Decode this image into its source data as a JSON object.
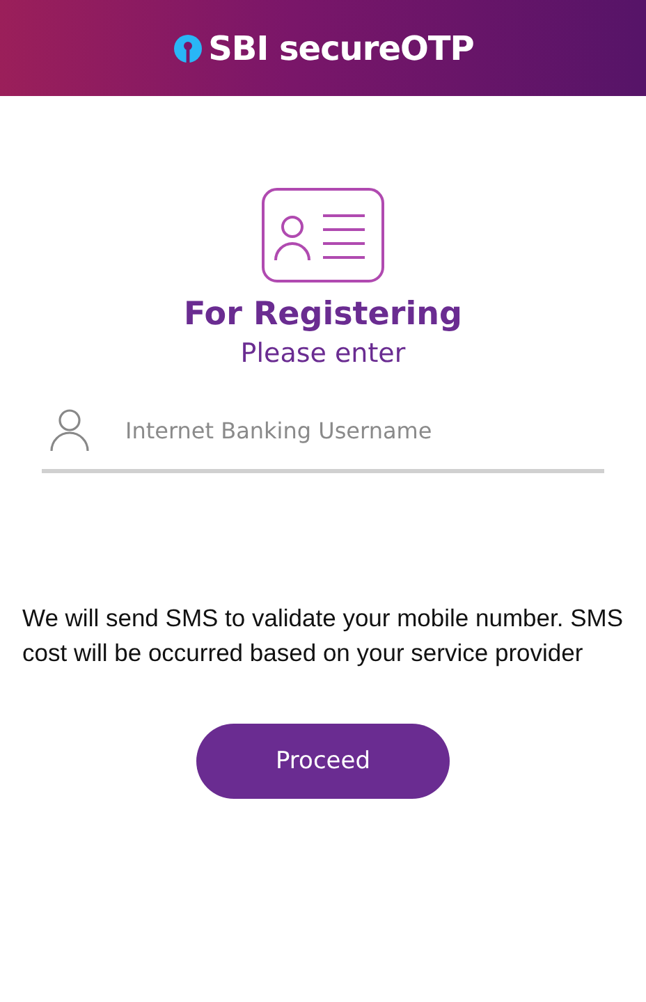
{
  "header": {
    "title": "SBI secureOTP"
  },
  "heading": "For Registering",
  "subheading": "Please enter",
  "username_field": {
    "placeholder": "Internet Banking Username"
  },
  "notice": "We will send SMS to validate your mobile number. SMS cost will be occurred based on your service provider",
  "buttons": [
    "Proceed"
  ]
}
